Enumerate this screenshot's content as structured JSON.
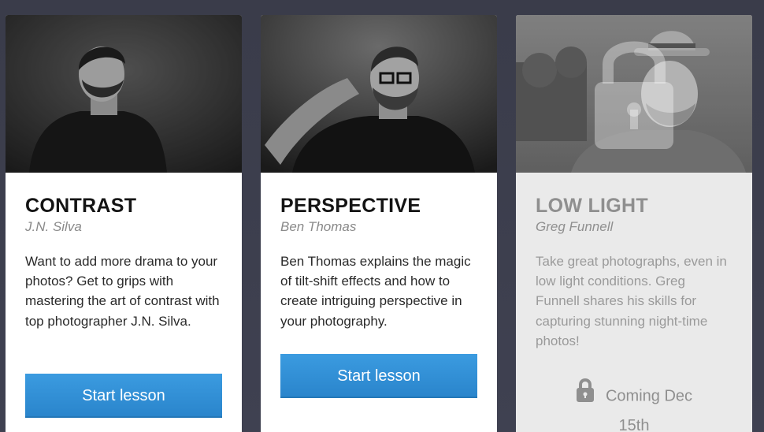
{
  "cards": [
    {
      "title": "CONTRAST",
      "author": "J.N. Silva",
      "description": "Want to add more drama to your photos? Get to grips with mastering the art of contrast with top photographer J.N. Silva.",
      "button_label": "Start lesson",
      "photo_icon": "portrait-photo"
    },
    {
      "title": "PERSPECTIVE",
      "author": "Ben Thomas",
      "description": "Ben Thomas explains the magic of tilt-shift effects and how to create intriguing perspective in your photography.",
      "button_label": "Start lesson",
      "photo_icon": "portrait-photo"
    },
    {
      "title": "LOW LIGHT",
      "author": "Greg Funnell",
      "description": "Take great photographs, even in low light conditions. Greg Funnell shares his skills for capturing stunning night-time photos!",
      "status_label": "Coming Dec",
      "status_date": "15th",
      "photo_icon": "portrait-photo",
      "lock_icon": "lock-icon"
    }
  ],
  "colors": {
    "background": "#3b3d4c",
    "button": "#2f8dd4",
    "locked_text": "#8f8f8f"
  }
}
